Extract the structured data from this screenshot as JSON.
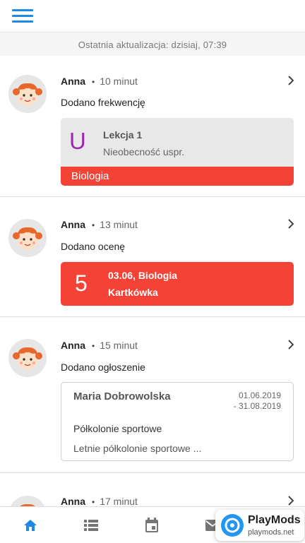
{
  "header": {
    "menu_icon": "hamburger-icon"
  },
  "last_update": "Ostatnia aktualizacja: dzisiaj, 07:39",
  "feed": [
    {
      "author": "Anna",
      "separator": "•",
      "time": "10 minut",
      "action": "Dodano frekwencję",
      "attendance": {
        "code": "U",
        "lesson": "Lekcja 1",
        "status": "Nieobecność uspr.",
        "subject": "Biologia"
      }
    },
    {
      "author": "Anna",
      "separator": "•",
      "time": "13 minut",
      "action": "Dodano ocenę",
      "grade": {
        "value": "5",
        "line1": "03.06, Biologia",
        "line2": "Kartkówka"
      }
    },
    {
      "author": "Anna",
      "separator": "•",
      "time": "15 minut",
      "action": "Dodano ogłoszenie",
      "announcement": {
        "author": "Maria Dobrowolska",
        "date_from": "01.06.2019",
        "date_to": "- 31.08.2019",
        "title": "Półkolonie sportowe",
        "body": "Letnie półkolonie sportowe ..."
      }
    },
    {
      "author": "Anna",
      "separator": "•",
      "time": "17 minut"
    }
  ],
  "colors": {
    "accent": "#1e88e5",
    "red": "#f44336",
    "purple": "#9c27b0",
    "icon_gray": "#757575"
  },
  "bottom_nav": [
    {
      "icon": "home-icon",
      "active": true
    },
    {
      "icon": "list-icon",
      "active": false
    },
    {
      "icon": "calendar-icon",
      "active": false
    },
    {
      "icon": "mail-icon",
      "active": false
    },
    {
      "icon": "more-icon",
      "active": false
    }
  ],
  "watermark": {
    "brand": "PlayMods",
    "url": "playmods.net"
  }
}
